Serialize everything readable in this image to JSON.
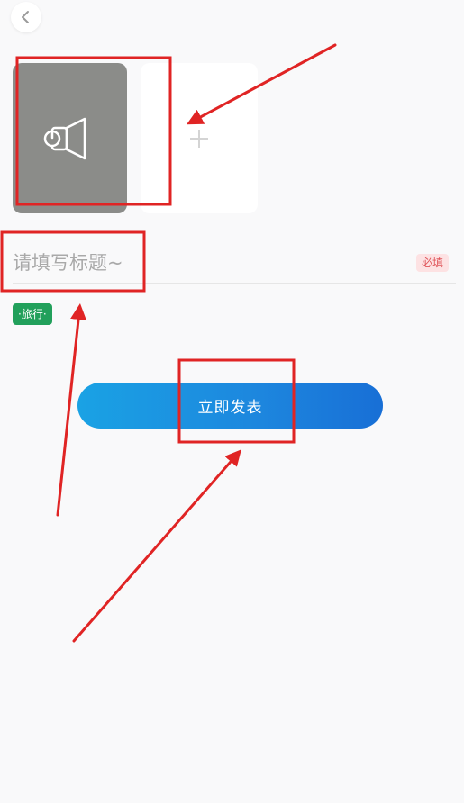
{
  "header": {
    "back_icon": "chevron-left-icon"
  },
  "media": {
    "tile_icon": "speaker-mouse-icon",
    "add_icon": "plus-icon"
  },
  "title_field": {
    "value": "",
    "placeholder": "请填写标题~",
    "required_label": "必填"
  },
  "tags": [
    {
      "label": "·旅行·"
    }
  ],
  "publish": {
    "label": "立即发表"
  },
  "colors": {
    "background": "#f9f9fa",
    "media_tile": "#8b8c89",
    "tag_green": "#22a05b",
    "required_bg": "#fde2e3",
    "required_text": "#e0565b",
    "button_gradient_start": "#1aa2e4",
    "button_gradient_end": "#186fd6",
    "annotation_red": "#e02424"
  }
}
